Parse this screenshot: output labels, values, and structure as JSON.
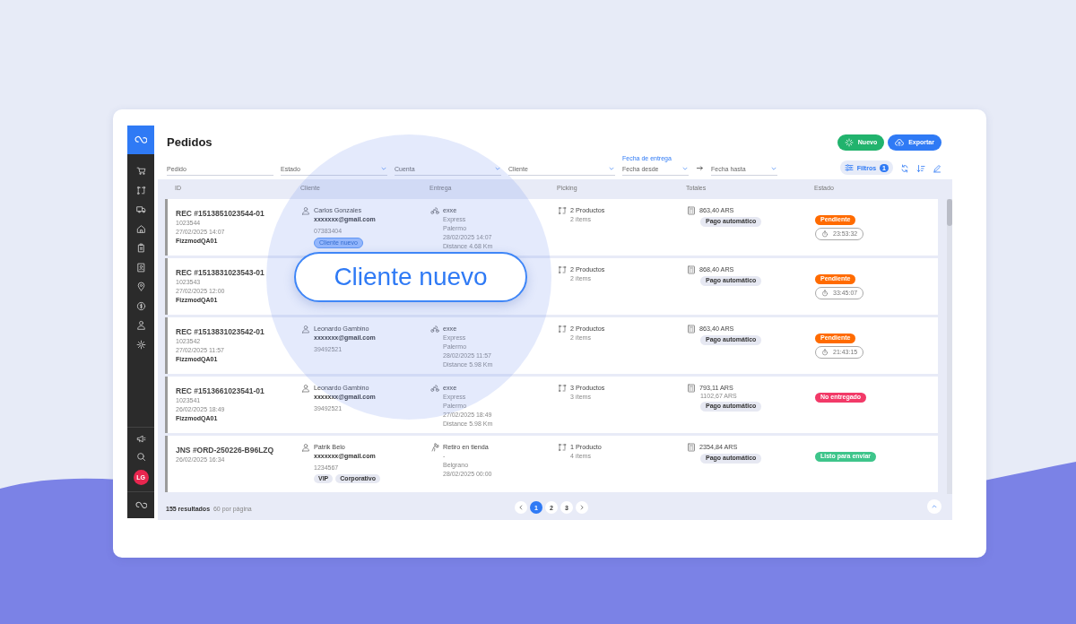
{
  "sidebar": {
    "avatar": "LG"
  },
  "header": {
    "title": "Pedidos",
    "buttons": [
      {
        "label": "Nuevo",
        "kind": "success"
      },
      {
        "label": "Exportar",
        "kind": "primary"
      }
    ]
  },
  "filters": {
    "fields": [
      {
        "placeholder": "Pedido",
        "kind": "text"
      },
      {
        "placeholder": "Estado",
        "kind": "select"
      },
      {
        "placeholder": "Cuenta",
        "kind": "select"
      },
      {
        "placeholder": "Cliente",
        "kind": "select"
      }
    ],
    "date_range": {
      "label": "Fecha de entrega",
      "from": "Fecha desde",
      "to": "Fecha hasta"
    },
    "filters_button": {
      "label": "Filtros",
      "count": "1"
    }
  },
  "table": {
    "columns": [
      "ID",
      "Cliente",
      "Entrega",
      "Picking",
      "Totales",
      "Estado"
    ],
    "rows": [
      {
        "id": "REC #1513851023544-01",
        "number": "1023544",
        "date": "27/02/2025 14:07",
        "account": "FizzmodQA01",
        "client": {
          "name": "Carlos Gonzales",
          "email": "xxxxxxx@gmail.com",
          "phone": "07383404",
          "tags": [
            {
              "label": "Cliente nuevo",
              "kind": "highlight"
            }
          ]
        },
        "delivery": {
          "kind": "motorbike",
          "carrier": "exxe",
          "lines": [
            "Express",
            "Palermo",
            "28/02/2025 14:07",
            "Distance 4.68 Km"
          ]
        },
        "picking": {
          "products": "2 Productos",
          "items": "2 ítems"
        },
        "totals": {
          "amount": "863,40 ARS",
          "payment": "Pago automático"
        },
        "status": {
          "label": "Pendiente",
          "color": "#ff6b00",
          "timer": "23:53:32"
        }
      },
      {
        "id": "REC #1513831023543-01",
        "number": "1023543",
        "date": "27/02/2025 12:00",
        "account": "FizzmodQA01",
        "picking": {
          "products": "2 Productos",
          "items": "2 ítems"
        },
        "totals": {
          "amount": "868,40 ARS",
          "payment": "Pago automático"
        },
        "status": {
          "label": "Pendiente",
          "color": "#ff6b00",
          "timer": "33:45:07"
        }
      },
      {
        "id": "REC #1513831023542-01",
        "number": "1023542",
        "date": "27/02/2025 11:57",
        "account": "FizzmodQA01",
        "client": {
          "name": "Leonardo Gambino",
          "email": "xxxxxxx@gmail.com",
          "phone": "39492521"
        },
        "delivery": {
          "kind": "motorbike",
          "carrier": "exxe",
          "lines": [
            "Express",
            "Palermo",
            "28/02/2025 11:57",
            "Distance 5.98 Km"
          ]
        },
        "picking": {
          "products": "2 Productos",
          "items": "2 ítems"
        },
        "totals": {
          "amount": "863,40 ARS",
          "payment": "Pago automático"
        },
        "status": {
          "label": "Pendiente",
          "color": "#ff6b00",
          "timer": "21:43:15"
        }
      },
      {
        "id": "REC #1513661023541-01",
        "number": "1023541",
        "date": "26/02/2025 18:49",
        "account": "FizzmodQA01",
        "client": {
          "name": "Leonardo Gambino",
          "email": "xxxxxxx@gmail.com",
          "phone": "39492521"
        },
        "delivery": {
          "kind": "motorbike",
          "carrier": "exxe",
          "lines": [
            "Express",
            "Palermo",
            "27/02/2025 18:49",
            "Distance 5.98 Km"
          ]
        },
        "picking": {
          "products": "3 Productos",
          "items": "3 ítems"
        },
        "totals": {
          "amount": "793,11 ARS",
          "original": "1102,67 ARS",
          "payment": "Pago automático"
        },
        "status": {
          "label": "No entregado",
          "color": "#f23a68"
        }
      },
      {
        "id": "JNS #ORD-250226-B96LZQ",
        "date": "26/02/2025 16:34",
        "client": {
          "name": "Patrik Belo",
          "email": "xxxxxxx@gmail.com",
          "phone": "1234567",
          "tags": [
            {
              "label": "VIP",
              "kind": "plain"
            },
            {
              "label": "Corporativo",
              "kind": "plain"
            }
          ]
        },
        "delivery": {
          "kind": "pickup",
          "carrier": "Retiro en tienda",
          "lines": [
            "-",
            "Belgrano",
            "28/02/2025 00:00"
          ]
        },
        "picking": {
          "products": "1 Producto",
          "items": "4 ítems"
        },
        "totals": {
          "amount": "2354,84 ARS",
          "payment": "Pago automático"
        },
        "status": {
          "label": "Listo para enviar",
          "color": "#3ec58b"
        }
      }
    ]
  },
  "footer": {
    "results": "155 resultados",
    "per_page": "60 por página",
    "pages": [
      {
        "label": "1",
        "selected": true
      },
      {
        "label": "2",
        "selected": false
      },
      {
        "label": "3",
        "selected": false
      }
    ]
  },
  "callout": {
    "label": "Cliente nuevo"
  }
}
